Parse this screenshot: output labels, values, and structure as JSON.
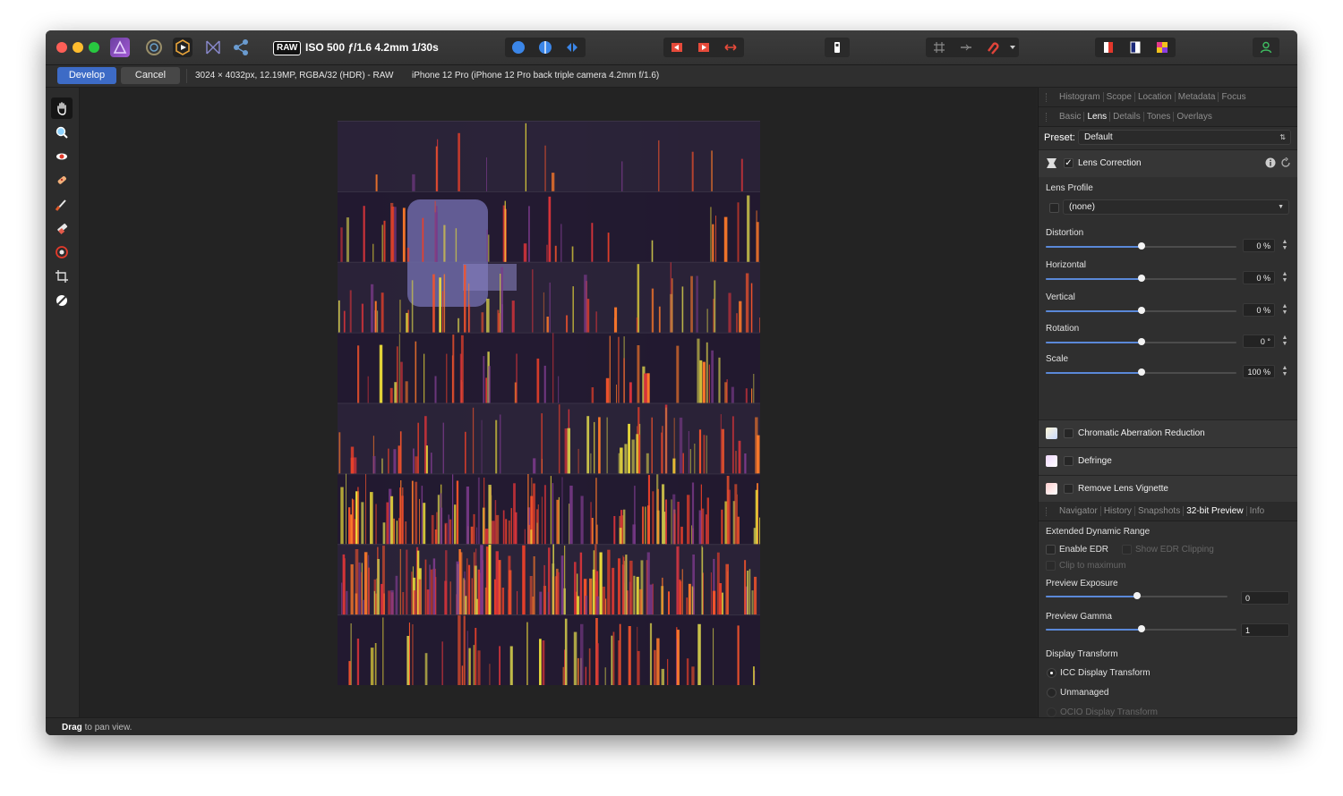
{
  "toolbar": {
    "raw_badge": "RAW",
    "raw_info": "ISO 500 ƒ/1.6 4.2mm 1/30s",
    "personas": [
      "photo-persona-icon",
      "liquify-persona-icon",
      "develop-persona-icon",
      "tone-mapping-persona-icon",
      "export-persona-icon"
    ]
  },
  "context": {
    "develop_label": "Develop",
    "cancel_label": "Cancel",
    "image_info": "3024 × 4032px, 12.19MP, RGBA/32 (HDR) - RAW",
    "camera_info": "iPhone 12 Pro (iPhone 12 Pro back triple camera 4.2mm f/1.6)"
  },
  "status": {
    "bold": "Drag",
    "rest": " to pan view."
  },
  "panel": {
    "top_tabs": [
      {
        "label": "Histogram",
        "selected": false
      },
      {
        "label": "Scope",
        "selected": false
      },
      {
        "label": "Location",
        "selected": false
      },
      {
        "label": "Metadata",
        "selected": false
      },
      {
        "label": "Focus",
        "selected": false
      }
    ],
    "dev_tabs": [
      {
        "label": "Basic",
        "selected": false
      },
      {
        "label": "Lens",
        "selected": true
      },
      {
        "label": "Details",
        "selected": false
      },
      {
        "label": "Tones",
        "selected": false
      },
      {
        "label": "Overlays",
        "selected": false
      }
    ],
    "preset_label": "Preset:",
    "preset_value": "Default",
    "lens_correction": {
      "title": "Lens Correction",
      "checked": "✓"
    },
    "lens_profile_label": "Lens Profile",
    "lens_profile_value": "(none)",
    "sliders": [
      {
        "label": "Distortion",
        "value": "0 %",
        "fraction": 0.5
      },
      {
        "label": "Horizontal",
        "value": "0 %",
        "fraction": 0.5
      },
      {
        "label": "Vertical",
        "value": "0 %",
        "fraction": 0.5
      },
      {
        "label": "Rotation",
        "value": "0 °",
        "fraction": 0.5
      },
      {
        "label": "Scale",
        "value": "100 %",
        "fraction": 0.5
      }
    ],
    "sections": [
      {
        "title": "Chromatic Aberration Reduction"
      },
      {
        "title": "Defringe"
      },
      {
        "title": "Remove Lens Vignette"
      }
    ],
    "bottom_tabs": [
      {
        "label": "Navigator",
        "selected": false
      },
      {
        "label": "History",
        "selected": false
      },
      {
        "label": "Snapshots",
        "selected": false
      },
      {
        "label": "32-bit Preview",
        "selected": true
      },
      {
        "label": "Info",
        "selected": false
      }
    ],
    "edr_heading": "Extended Dynamic Range",
    "enable_edr": "Enable EDR",
    "show_edr_clipping": "Show EDR Clipping",
    "clip_to_max": "Clip to maximum",
    "preview_exposure_label": "Preview Exposure",
    "preview_exposure_value": "0",
    "preview_exposure_fraction": 0.5,
    "preview_gamma_label": "Preview Gamma",
    "preview_gamma_value": "1",
    "preview_gamma_fraction": 0.5,
    "display_transform_heading": "Display Transform",
    "icc_transform": "ICC Display Transform",
    "unmanaged": "Unmanaged",
    "ocio_transform": "OCIO Display Transform"
  },
  "colors": {
    "accent": "#3d6bc6",
    "slider": "#5a88d8"
  }
}
